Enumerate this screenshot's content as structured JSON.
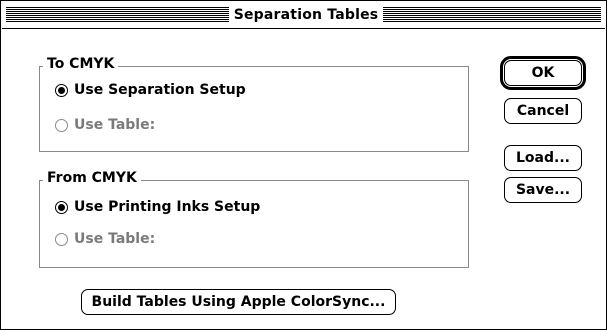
{
  "window": {
    "title": "Separation Tables"
  },
  "to_cmyk": {
    "label": "To CMYK",
    "options": [
      {
        "label": "Use Separation Setup",
        "selected": true,
        "enabled": true
      },
      {
        "label": "Use Table:",
        "selected": false,
        "enabled": false
      }
    ]
  },
  "from_cmyk": {
    "label": "From CMYK",
    "options": [
      {
        "label": "Use Printing Inks Setup",
        "selected": true,
        "enabled": true
      },
      {
        "label": "Use Table:",
        "selected": false,
        "enabled": false
      }
    ]
  },
  "buttons": {
    "ok": "OK",
    "cancel": "Cancel",
    "load": "Load...",
    "save": "Save...",
    "build_tables": "Build Tables Using Apple ColorSync..."
  }
}
